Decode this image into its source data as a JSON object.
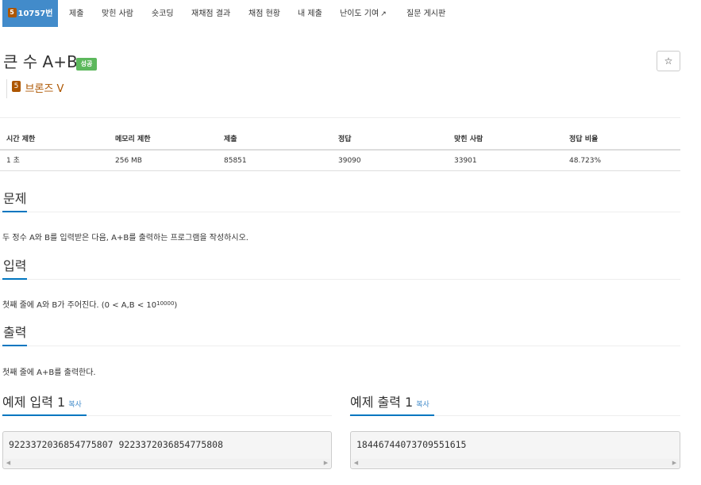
{
  "tabs": {
    "problem_id": "10757번",
    "tier_badge": "5",
    "items": [
      "제출",
      "맞힌 사람",
      "숏코딩",
      "재채점 결과",
      "채점 현황",
      "내 제출",
      "난이도 기여",
      "질문 게시판"
    ],
    "external_icon": "external-link-icon"
  },
  "problem": {
    "title": "큰 수 A+B",
    "status_badge": "성공",
    "star_glyph": "☆",
    "tier_number": "5",
    "tier_text": "브론즈 V"
  },
  "info_table": {
    "headers": [
      "시간 제한",
      "메모리 제한",
      "제출",
      "정답",
      "맞힌 사람",
      "정답 비율"
    ],
    "values": [
      "1 초",
      "256 MB",
      "85851",
      "39090",
      "33901",
      "48.723%"
    ]
  },
  "sections": {
    "problem_title": "문제",
    "problem_text": "두 정수 A와 B를 입력받은 다음, A+B를 출력하는 프로그램을 작성하시오.",
    "input_title": "입력",
    "input_text_prefix": "첫째 줄에 A와 B가 주어진다. (0 < A,B < 10",
    "input_text_sup": "10000",
    "input_text_suffix": ")",
    "output_title": "출력",
    "output_text": "첫째 줄에 A+B를 출력한다."
  },
  "samples": {
    "input_title": "예제 입력 1",
    "output_title": "예제 출력 1",
    "copy_label": "복사",
    "input_value": "9223372036854775807 9223372036854775808",
    "output_value": "18446744073709551615"
  },
  "colors": {
    "accent": "#428bca",
    "success": "#5cb85c",
    "bronze": "#ad5600",
    "underline": "#0076c0"
  }
}
